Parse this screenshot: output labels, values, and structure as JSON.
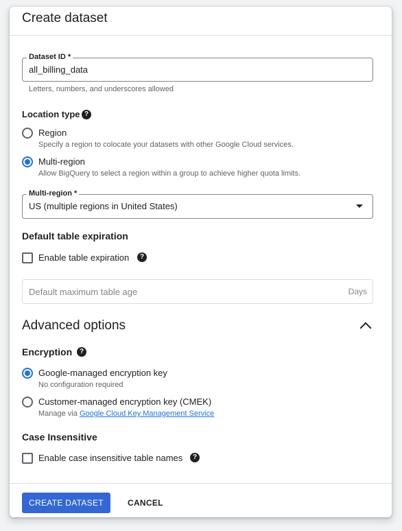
{
  "dialog": {
    "title": "Create dataset"
  },
  "dataset_id": {
    "label": "Dataset ID *",
    "value": "all_billing_data",
    "hint": "Letters, numbers, and underscores allowed"
  },
  "location_type": {
    "title": "Location type",
    "options": [
      {
        "label": "Region",
        "description": "Specify a region to colocate your datasets with other Google Cloud services.",
        "checked": false
      },
      {
        "label": "Multi-region",
        "description": "Allow BigQuery to select a region within a group to achieve higher quota limits.",
        "checked": true
      }
    ]
  },
  "multi_region": {
    "label": "Multi-region *",
    "value": "US (multiple regions in United States)"
  },
  "table_expiration": {
    "title": "Default table expiration",
    "checkbox_label": "Enable table expiration",
    "checked": false,
    "max_age_placeholder": "Default maximum table age",
    "unit": "Days"
  },
  "advanced": {
    "title": "Advanced options",
    "expanded": true
  },
  "encryption": {
    "title": "Encryption",
    "options": [
      {
        "label": "Google-managed encryption key",
        "description": "No configuration required",
        "checked": true
      },
      {
        "label": "Customer-managed encryption key (CMEK)",
        "description_prefix": "Manage via",
        "link_text": "Google Cloud Key Management Service",
        "checked": false
      }
    ]
  },
  "case_insensitive": {
    "title": "Case Insensitive",
    "checkbox_label": "Enable case insensitive table names",
    "checked": false
  },
  "footer": {
    "create_label": "CREATE DATASET",
    "cancel_label": "CANCEL"
  },
  "colors": {
    "accent": "#1a73e8",
    "primary_button": "#3367d6"
  },
  "icons": {
    "help": "help-circle-icon",
    "dropdown": "dropdown-arrow-icon",
    "collapse": "chevron-up-icon"
  }
}
